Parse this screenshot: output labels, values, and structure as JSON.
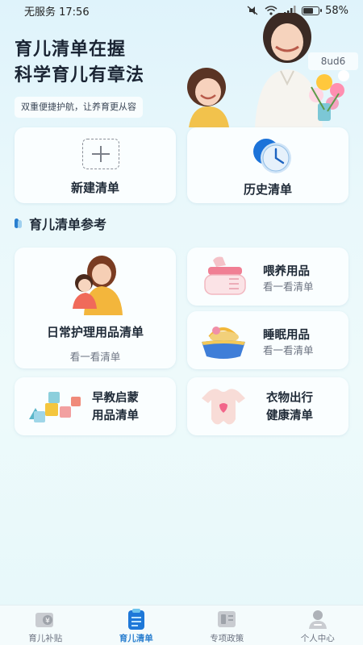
{
  "status_bar": {
    "carrier_time": "无服务 17:56",
    "battery": "58%",
    "battery_level": 0.58
  },
  "hero": {
    "title_line1": "育儿清单在握",
    "title_line2": "科学育儿有章法",
    "subtitle": "双重便捷护航，让养育更从容",
    "watermark": "8ud6"
  },
  "quick_actions": {
    "new_list": "新建清单",
    "history": "历史清单"
  },
  "section": {
    "title": "育儿清单参考"
  },
  "references": {
    "daily": {
      "title": "日常护理用品清单",
      "action": "看一看清单"
    },
    "feeding": {
      "title": "喂养用品",
      "action": "看一看清单"
    },
    "sleep": {
      "title": "睡眠用品",
      "action": "看一看清单"
    },
    "early_edu": {
      "line1": "早教启蒙",
      "line2": "用品清单"
    },
    "clothes": {
      "line1": "衣物出行",
      "line2": "健康清单"
    }
  },
  "tabbar": {
    "items": [
      {
        "label": "育儿补贴",
        "icon": "wallet-yuan-icon"
      },
      {
        "label": "育儿清单",
        "icon": "checklist-icon"
      },
      {
        "label": "专项政策",
        "icon": "policy-book-icon"
      },
      {
        "label": "个人中心",
        "icon": "user-icon"
      }
    ],
    "active_index": 1
  },
  "colors": {
    "accent": "#2a7fcf",
    "background": "#e6f6fa"
  }
}
